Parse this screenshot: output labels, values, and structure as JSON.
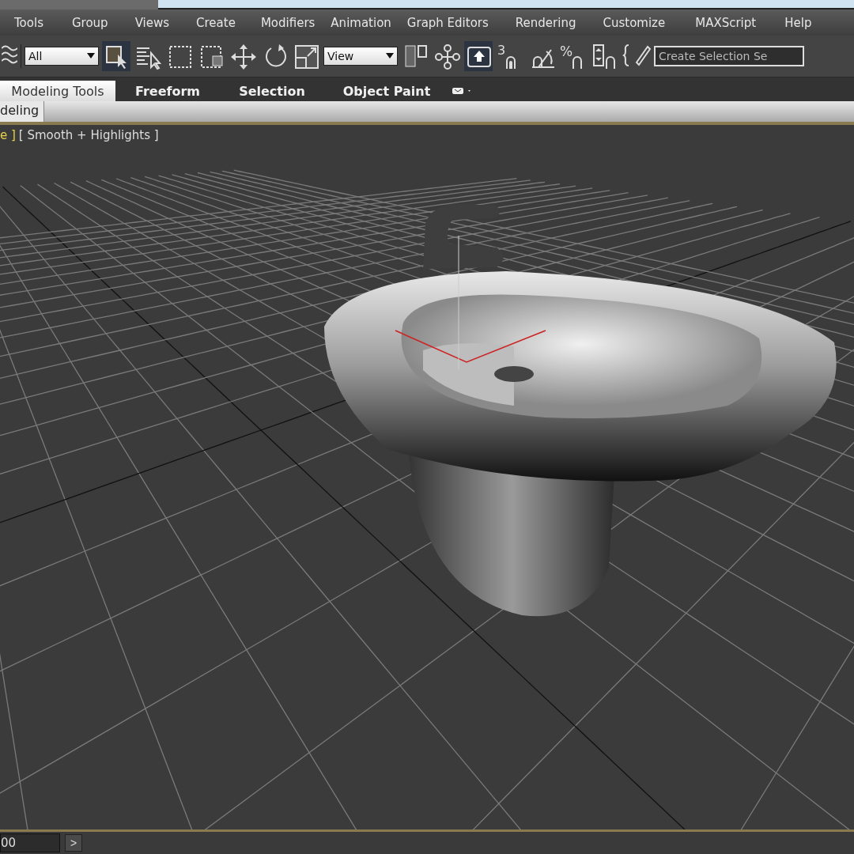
{
  "menu_bar": {
    "items": [
      "Tools",
      "Group",
      "Views",
      "Create",
      "Modifiers",
      "Animation",
      "Graph Editors",
      "Rendering",
      "Customize",
      "MAXScript",
      "Help"
    ]
  },
  "main_toolbar": {
    "selection_filter": "All",
    "reference_coordinate": "View",
    "snap_marks": [
      "3",
      "%"
    ],
    "named_selection": {
      "placeholder": "Create Selection Se"
    }
  },
  "ribbon": {
    "tabs": [
      {
        "label": "Modeling Tools",
        "selected": true
      },
      {
        "label": "Freeform",
        "selected": false
      },
      {
        "label": "Selection",
        "selected": false
      },
      {
        "label": "Object Paint",
        "selected": false
      }
    ],
    "panel_tab": "deling"
  },
  "viewport": {
    "label_view": "e ]",
    "label_shading": "[ Smooth + Highlights ]"
  },
  "time_slider": {
    "frame": "00",
    "next_button": ">"
  }
}
